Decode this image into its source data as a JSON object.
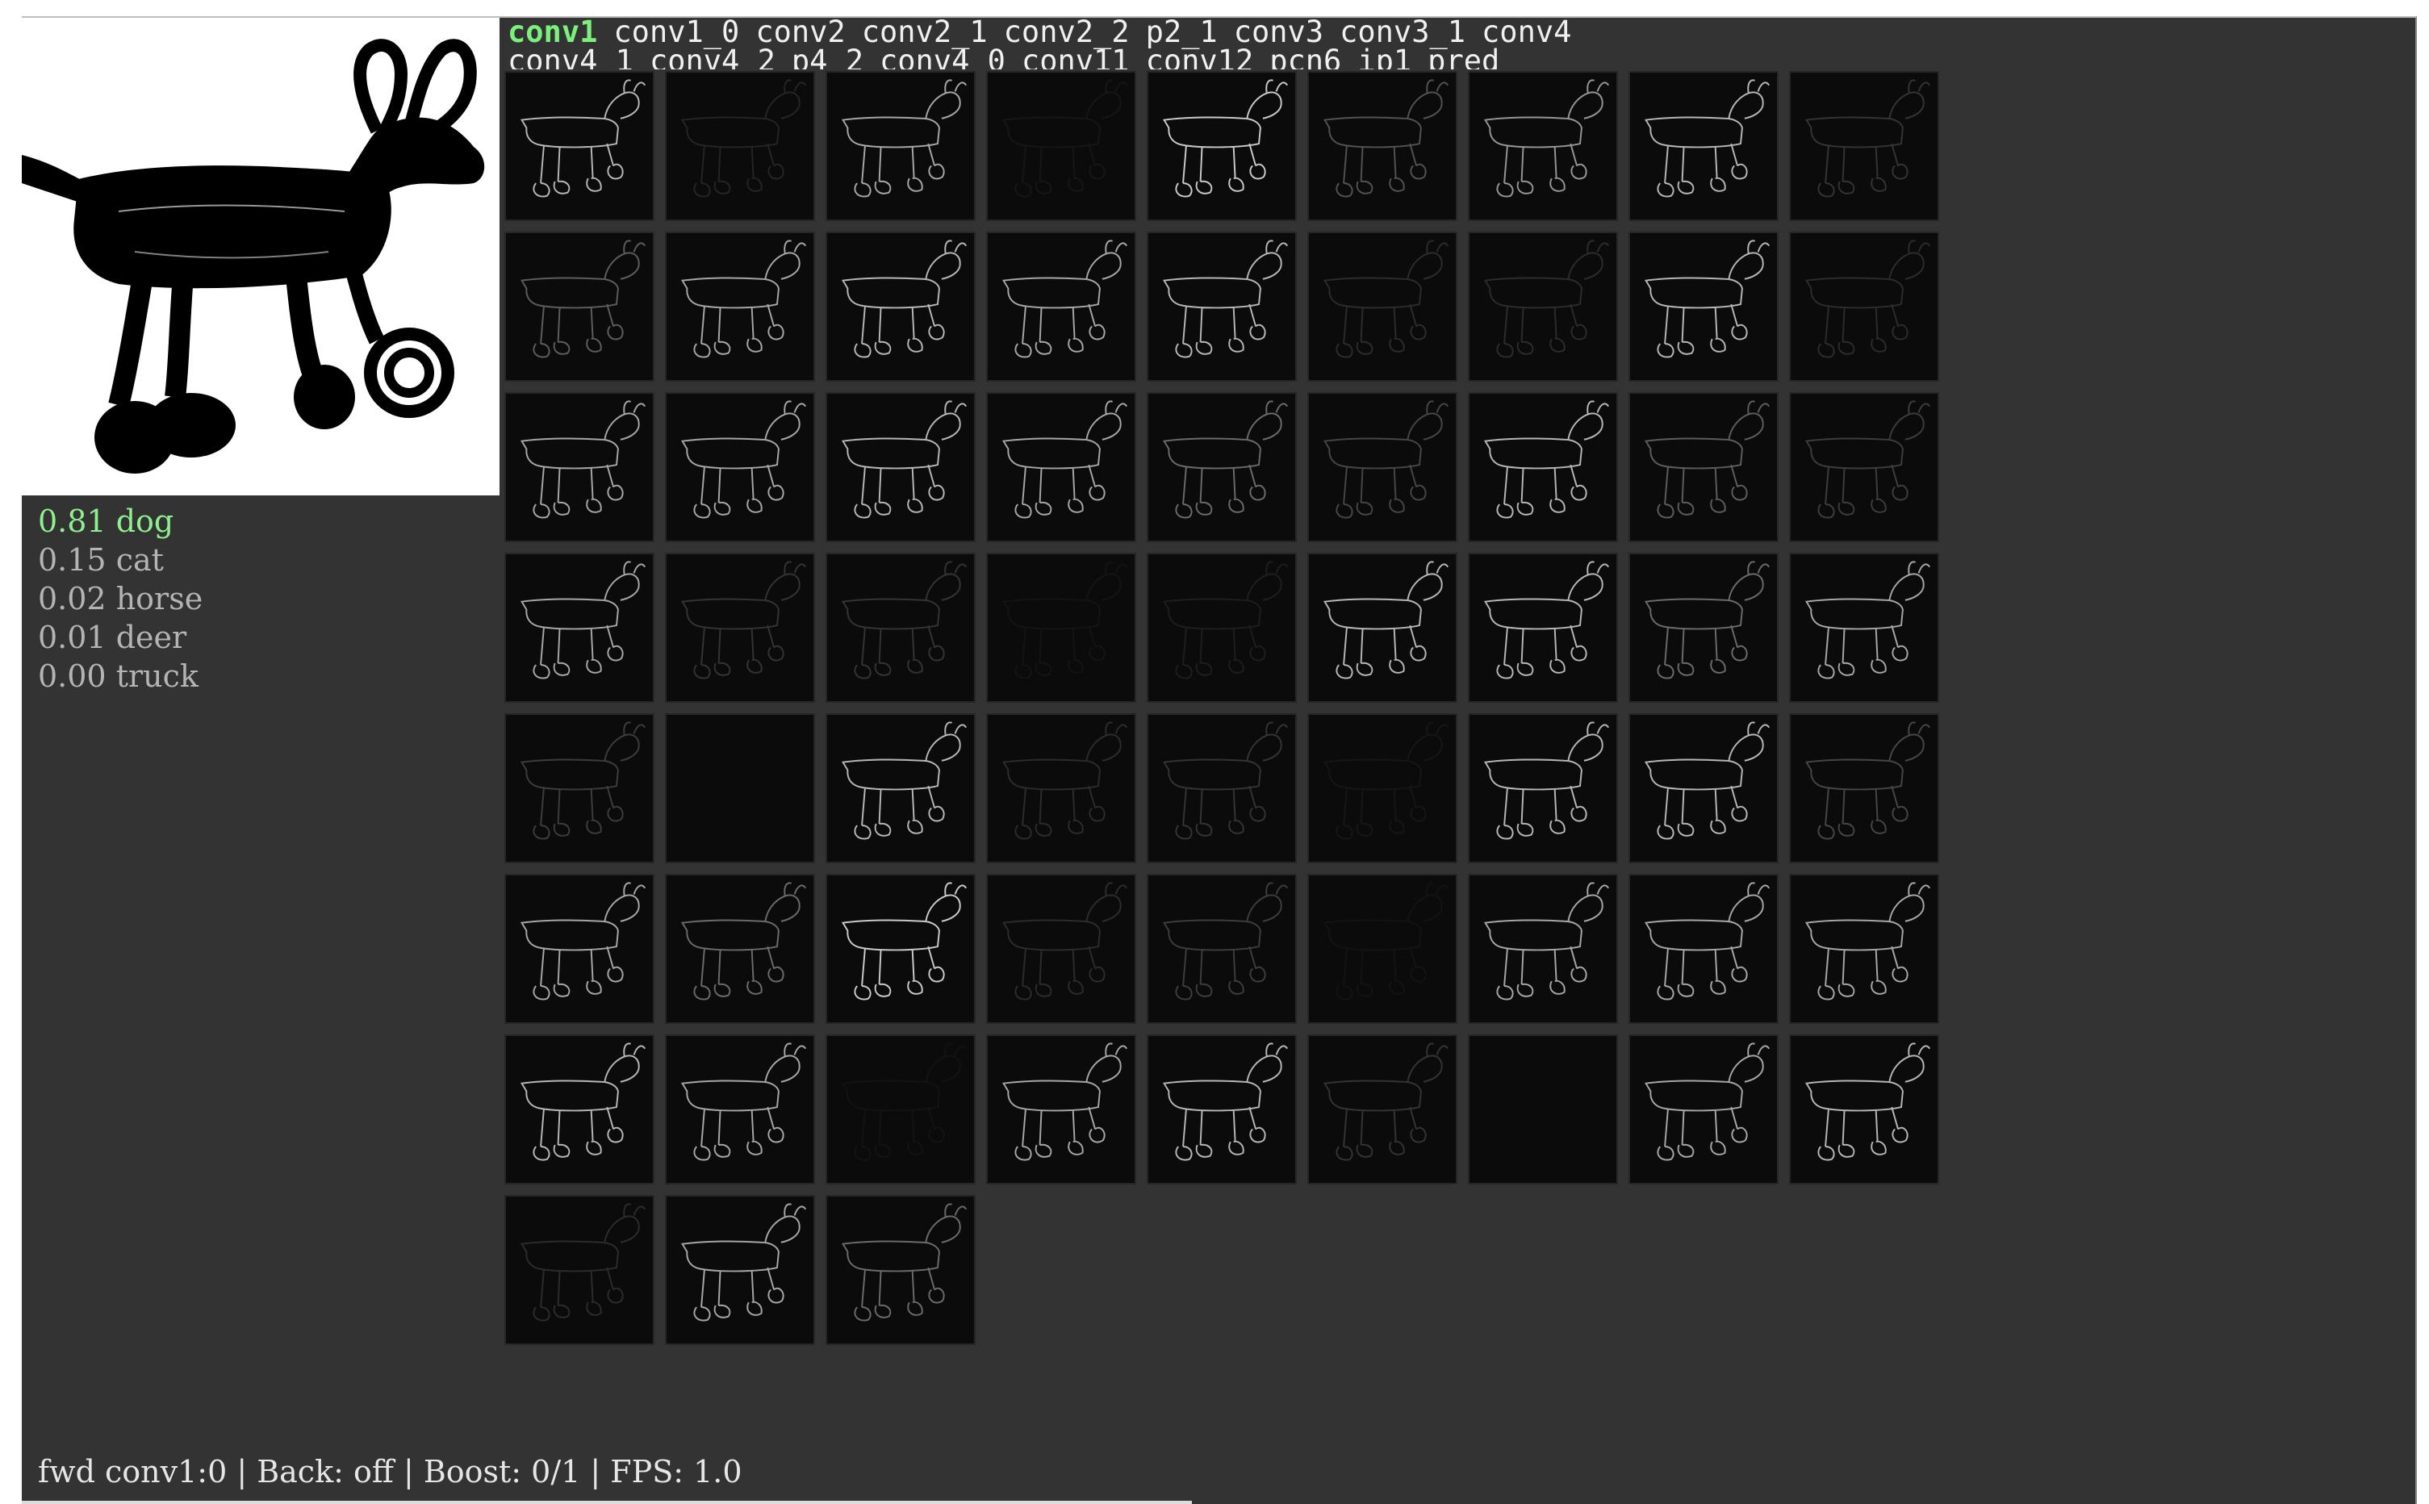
{
  "layer_tabs": {
    "active": "conv1",
    "row1": [
      "conv1_0",
      "conv2",
      "conv2_1",
      "conv2_2",
      "p2_1",
      "conv3",
      "conv3_1",
      "conv4"
    ],
    "row2": [
      "conv4_1",
      "conv4_2",
      "p4_2",
      "conv4_0",
      "conv11",
      "conv12",
      "pcn6",
      "ip1",
      "pred"
    ]
  },
  "predictions": [
    {
      "score": "0.81",
      "label": "dog",
      "top": true
    },
    {
      "score": "0.15",
      "label": "cat",
      "top": false
    },
    {
      "score": "0.02",
      "label": "horse",
      "top": false
    },
    {
      "score": "0.01",
      "label": "deer",
      "top": false
    },
    {
      "score": "0.00",
      "label": "truck",
      "top": false
    }
  ],
  "status": {
    "text": "fwd conv1:0 | Back: off | Boost: 0/1 | FPS: 1.0"
  },
  "grid": {
    "columns": 9,
    "tile_count": 66,
    "tile_brightness": [
      0.85,
      0.25,
      0.8,
      0.12,
      0.9,
      0.5,
      0.75,
      0.85,
      0.35,
      0.55,
      0.8,
      0.85,
      0.8,
      0.85,
      0.3,
      0.3,
      0.85,
      0.3,
      0.8,
      0.8,
      0.85,
      0.8,
      0.6,
      0.45,
      0.85,
      0.55,
      0.4,
      0.8,
      0.35,
      0.35,
      0.1,
      0.2,
      0.85,
      0.85,
      0.6,
      0.8,
      0.4,
      0.0,
      0.85,
      0.3,
      0.35,
      0.12,
      0.85,
      0.85,
      0.45,
      0.8,
      0.6,
      0.9,
      0.3,
      0.4,
      0.08,
      0.8,
      0.8,
      0.8,
      0.85,
      0.8,
      0.08,
      0.8,
      0.85,
      0.35,
      0.0,
      0.8,
      0.85,
      0.3,
      0.8,
      0.6
    ]
  }
}
